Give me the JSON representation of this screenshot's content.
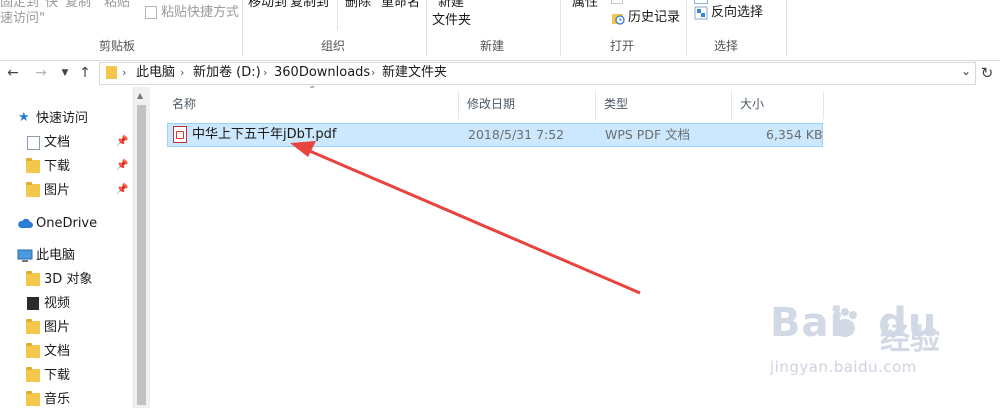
{
  "ribbon": {
    "pin_quick_access": "固定到\"快\n速访问\"",
    "copy": "复制",
    "paste": "粘贴",
    "paste_shortcut": "粘贴快捷方式",
    "move_to": "移动到",
    "copy_to": "复制到",
    "delete": "删除",
    "rename": "重命名",
    "new_folder_line1": "新建",
    "new_folder_line2": "文件夹",
    "properties": "属性",
    "history": "历史记录",
    "invert_selection": "反向选择",
    "groups": {
      "clipboard": "剪贴板",
      "organize": "组织",
      "new": "新建",
      "open": "打开",
      "select": "选择"
    }
  },
  "address_bar": {
    "crumbs": [
      "此电脑",
      "新加卷 (D:)",
      "360Downloads",
      "新建文件夹"
    ]
  },
  "nav_pane": {
    "quick_access": "快速访问",
    "quick_items": [
      "文档",
      "下载",
      "图片"
    ],
    "onedrive": "OneDrive",
    "this_pc": "此电脑",
    "pc_items": [
      "3D 对象",
      "视频",
      "图片",
      "文档",
      "下载",
      "音乐"
    ]
  },
  "columns": {
    "name": "名称",
    "modified": "修改日期",
    "type": "类型",
    "size": "大小"
  },
  "files": [
    {
      "name": "中华上下五千年jDbT.pdf",
      "modified": "2018/5/31 7:52",
      "type": "WPS PDF 文档",
      "size": "6,354 KB"
    }
  ],
  "watermark": {
    "logo": "Bai",
    "logo_tail": "du",
    "cn": "经验",
    "url": "jingyan.baidu.com"
  },
  "colors": {
    "selection_bg": "#cce8ff",
    "selection_border": "#99d1ff",
    "arrow": "#e8433f",
    "folder": "#f3c64c",
    "accent": "#1e78d6"
  },
  "icons": {
    "file": "pdf-icon",
    "quick_access": "star-icon",
    "onedrive": "cloud-icon",
    "this_pc": "computer-icon"
  }
}
